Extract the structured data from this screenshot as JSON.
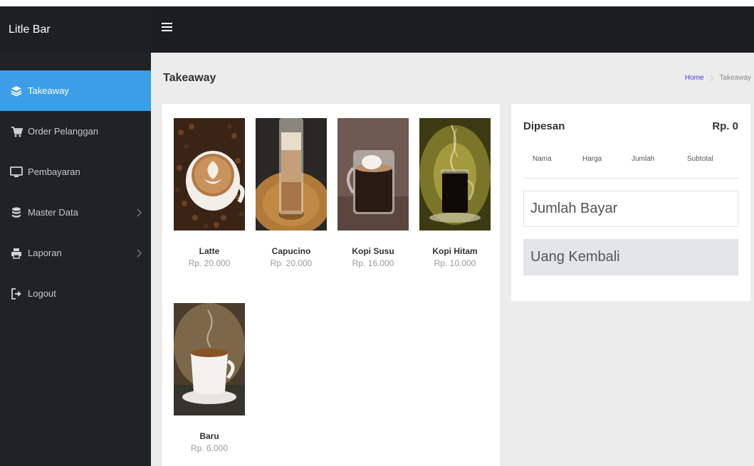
{
  "app": {
    "brand": "Litle Bar"
  },
  "sidebar": {
    "items": [
      {
        "label": "Takeaway",
        "icon": "layers-icon",
        "active": true,
        "has_submenu": false
      },
      {
        "label": "Order Pelanggan",
        "icon": "cart-icon",
        "active": false,
        "has_submenu": false
      },
      {
        "label": "Pembayaran",
        "icon": "monitor-icon",
        "active": false,
        "has_submenu": false
      },
      {
        "label": "Master Data",
        "icon": "database-icon",
        "active": false,
        "has_submenu": true
      },
      {
        "label": "Laporan",
        "icon": "printer-icon",
        "active": false,
        "has_submenu": true
      },
      {
        "label": "Logout",
        "icon": "logout-icon",
        "active": false,
        "has_submenu": false
      }
    ]
  },
  "page": {
    "title": "Takeaway",
    "breadcrumb": {
      "home": "Home",
      "current": "Takeaway"
    }
  },
  "products": [
    {
      "name": "Latte",
      "price": "Rp. 20.000",
      "image": "latte-art-cup"
    },
    {
      "name": "Capucino",
      "price": "Rp. 20.000",
      "image": "tall-iced-glass"
    },
    {
      "name": "Kopi Susu",
      "price": "Rp. 16.000",
      "image": "glass-mug-with-milk"
    },
    {
      "name": "Kopi Hitam",
      "price": "Rp. 10.000",
      "image": "black-coffee-glass-steam"
    },
    {
      "name": "Baru",
      "price": "Rp. 6.000",
      "image": "white-cup-steam"
    }
  ],
  "order": {
    "title": "Dipesan",
    "total": "Rp. 0",
    "columns": [
      "Nama",
      "Harga",
      "Jumlah",
      "Subtotal"
    ],
    "pay_placeholder": "Jumlah Bayar",
    "change_placeholder": "Uang Kembali"
  },
  "colors": {
    "accent": "#3b9ee8",
    "sidebar": "#1f2328",
    "topbar": "#1b1d21",
    "link": "#4b3bd6"
  }
}
